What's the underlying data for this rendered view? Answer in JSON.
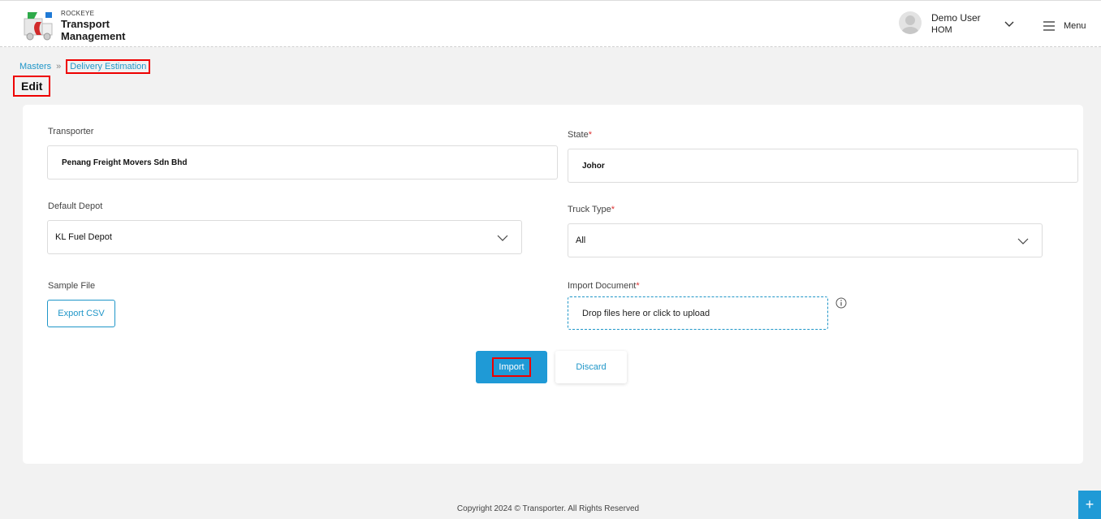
{
  "header": {
    "brand_small": "ROCKEYE",
    "brand_line1": "Transport",
    "brand_line2": "Management",
    "user_name": "Demo User",
    "user_role": "HOM",
    "menu_label": "Menu"
  },
  "breadcrumb": {
    "root": "Masters",
    "current": "Delivery Estimation"
  },
  "page": {
    "title": "Edit"
  },
  "form": {
    "transporter_label": "Transporter",
    "transporter_value": "Penang Freight Movers Sdn Bhd",
    "state_label": "State",
    "state_value": "Johor",
    "default_depot_label": "Default Depot",
    "default_depot_value": "KL Fuel Depot",
    "truck_type_label": "Truck Type",
    "truck_type_value": "All",
    "sample_file_label": "Sample File",
    "export_csv_label": "Export CSV",
    "import_document_label": "Import Document",
    "dropzone_text": "Drop files here or click to upload",
    "required_marker": "*"
  },
  "actions": {
    "import_label": "Import",
    "discard_label": "Discard"
  },
  "footer": {
    "text": "Copyright 2024 © Transporter. All Rights Reserved"
  },
  "fab": {
    "icon": "plus-icon",
    "label": "+"
  },
  "colors": {
    "accent": "#1f9ad6",
    "highlight_border": "#ee0000",
    "required": "#dd3333"
  }
}
